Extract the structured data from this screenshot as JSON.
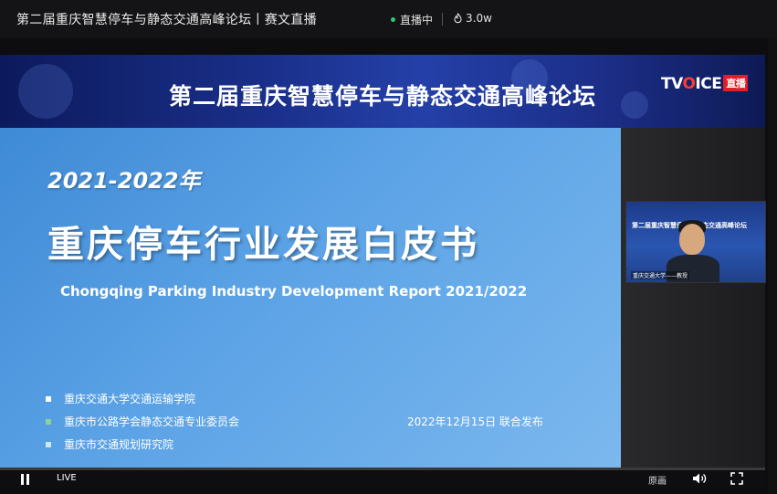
{
  "window": {
    "title": "第二届重庆智慧停车与静态交通高峰论坛丨赛文直播",
    "status": "直播中",
    "views": "3.0w",
    "status_color": "#2ecc71"
  },
  "banner": {
    "title": "第二届重庆智慧停车与静态交通高峰论坛",
    "logo_text_1": "TV",
    "logo_text_2": "O",
    "logo_text_3": "ICE",
    "logo_tag": "直播"
  },
  "slide": {
    "years": "2021-2022年",
    "cn_title": "重庆停车行业发展白皮书",
    "en_title": "Chongqing Parking Industry Development Report 2021/2022",
    "orgs": [
      {
        "label": "重庆交通大学交通运输学院",
        "color": "#ffffff"
      },
      {
        "label": "重庆市公路学会静态交通专业委员会",
        "color": "#8fd18f"
      },
      {
        "label": "重庆市交通规划研究院",
        "color": "#cfe6ff"
      }
    ],
    "date": "2022年12月15日  联合发布"
  },
  "pip": {
    "title": "第二届重庆智慧停车与静态交通高峰论坛",
    "label": "重庆交通大学——教授"
  },
  "controls": {
    "live": "LIVE",
    "quality": "原画",
    "icons": [
      "pause-icon",
      "volume-icon",
      "fullscreen-icon"
    ]
  }
}
